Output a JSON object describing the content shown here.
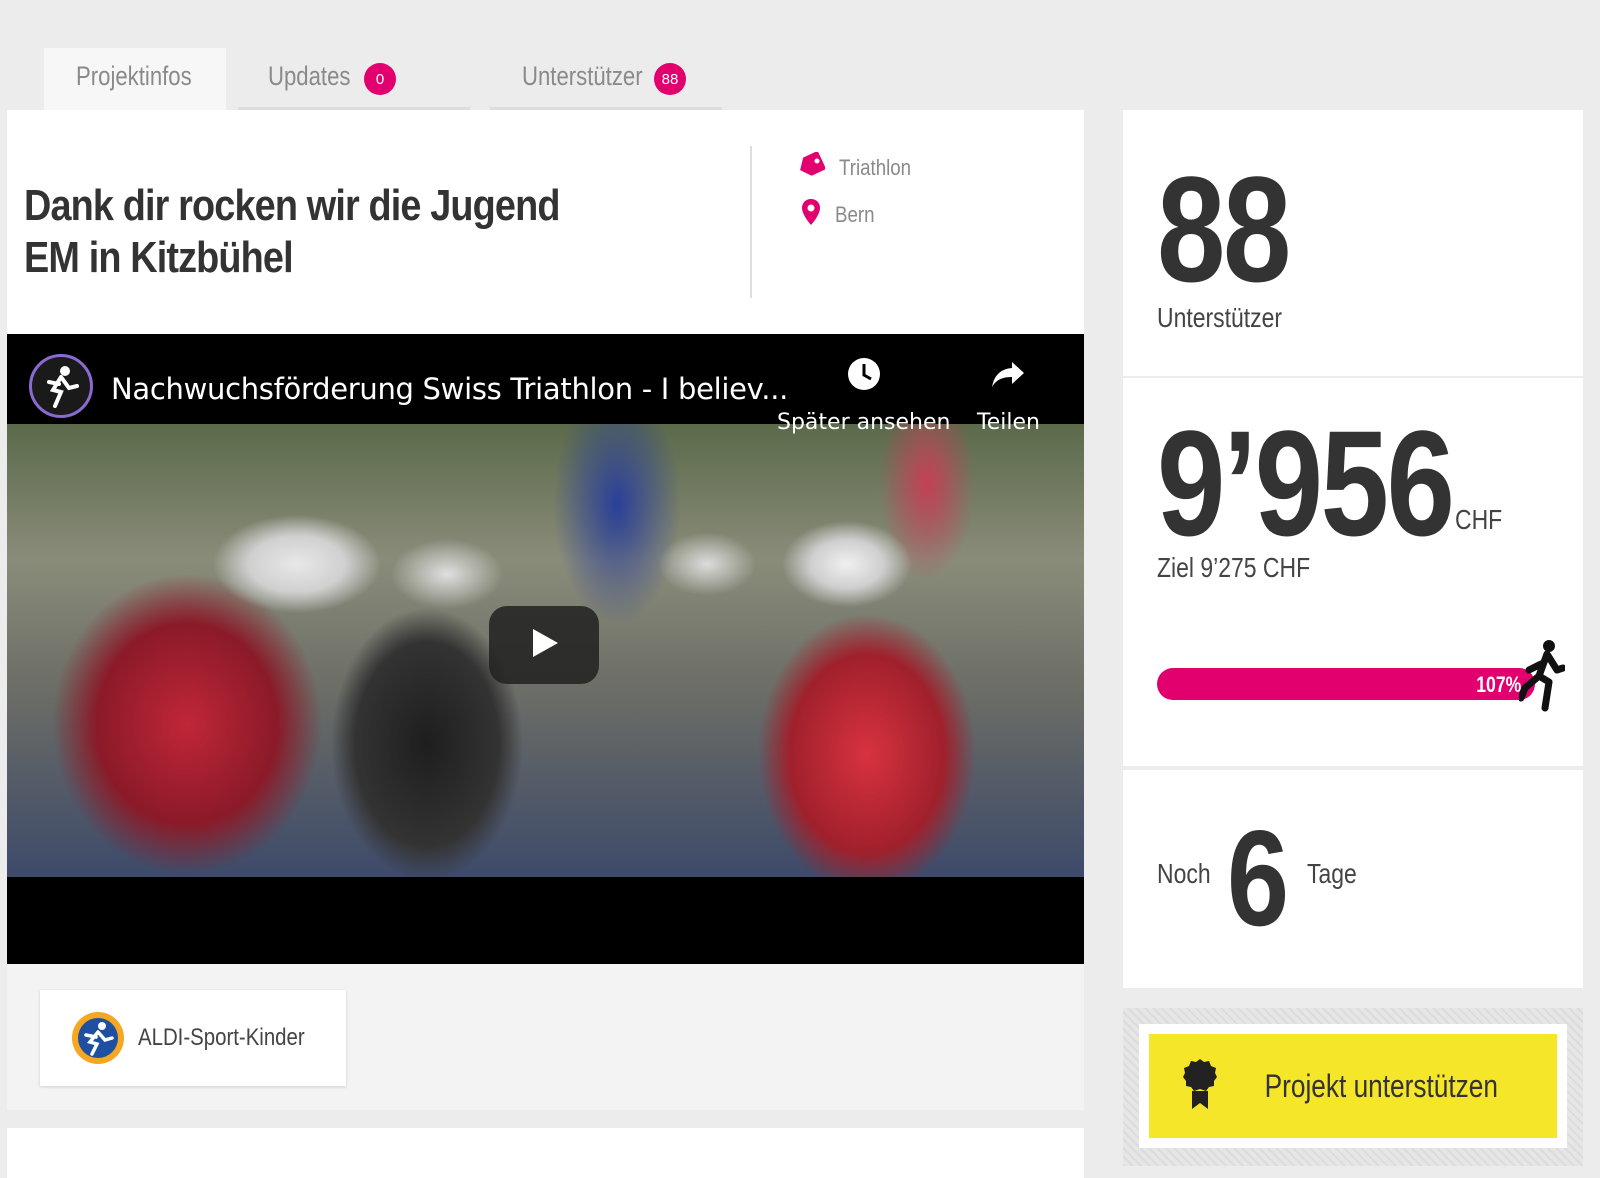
{
  "tabs": [
    {
      "label": "Projektinfos",
      "active": true
    },
    {
      "label": "Updates",
      "badge": "0"
    },
    {
      "label": "Unterstützer",
      "badge": "88"
    }
  ],
  "project": {
    "title": "Dank dir rocken wir die Jugend EM in Kitzbühel",
    "category": "Triathlon",
    "location": "Bern",
    "category_icon": "tag-icon",
    "location_icon": "map-pin-icon"
  },
  "video": {
    "title": "Nachwuchsförderung Swiss Triathlon - I believ...",
    "watch_later_label": "Später ansehen",
    "share_label": "Teilen"
  },
  "sponsor": {
    "name": "ALDI-Sport-Kinder"
  },
  "stats": {
    "supporters_count": "88",
    "supporters_label": "Unterstützer",
    "amount": "9’956",
    "currency": "CHF",
    "goal_text": "Ziel 9’275 CHF",
    "progress_percent": 107,
    "progress_label": "107%",
    "days_prefix": "Noch",
    "days_left": "6",
    "days_suffix": "Tage"
  },
  "cta": {
    "label": "Projekt unterstützen",
    "icon": "award-ribbon-icon"
  },
  "colors": {
    "accent": "#e2006e",
    "cta": "#f5e62a",
    "text": "#333333"
  }
}
